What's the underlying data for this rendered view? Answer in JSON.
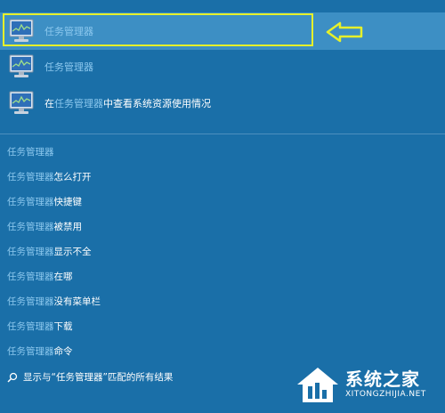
{
  "best_matches": [
    {
      "highlight": "任务管理器",
      "suffix": "",
      "prefix": "",
      "icon": "task-manager-icon"
    },
    {
      "highlight": "任务管理器",
      "suffix": "",
      "prefix": "",
      "icon": "task-manager-icon"
    },
    {
      "prefix": "在",
      "highlight": "任务管理器",
      "suffix": "中查看系统资源使用情况",
      "icon": "task-manager-icon"
    }
  ],
  "suggestions": [
    {
      "highlight": "任务管理器",
      "suffix": ""
    },
    {
      "highlight": "任务管理器",
      "suffix": "怎么打开"
    },
    {
      "highlight": "任务管理器",
      "suffix": "快捷键"
    },
    {
      "highlight": "任务管理器",
      "suffix": "被禁用"
    },
    {
      "highlight": "任务管理器",
      "suffix": "显示不全"
    },
    {
      "highlight": "任务管理器",
      "suffix": "在哪"
    },
    {
      "highlight": "任务管理器",
      "suffix": "没有菜单栏"
    },
    {
      "highlight": "任务管理器",
      "suffix": "下载"
    },
    {
      "highlight": "任务管理器",
      "suffix": "命令"
    }
  ],
  "search_all": {
    "text": "显示与“任务管理器”匹配的所有结果",
    "icon": "search-icon"
  },
  "watermark": {
    "name": "系统之家",
    "url": "XITONGZHIJIA.NET"
  },
  "colors": {
    "background": "#1a6fa8",
    "selected_row": "#3d8fc4",
    "highlight_box": "#e6f02a",
    "query_text": "#8cc8ee"
  }
}
